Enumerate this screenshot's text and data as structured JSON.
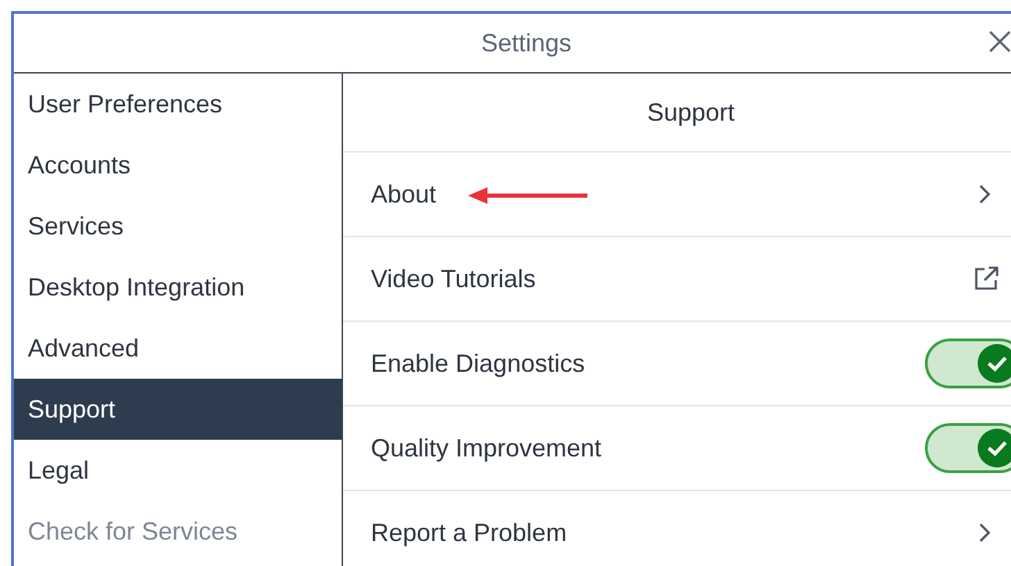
{
  "window": {
    "title": "Settings"
  },
  "sidebar": {
    "items": [
      {
        "label": "User Preferences",
        "selected": false,
        "disabled": false
      },
      {
        "label": "Accounts",
        "selected": false,
        "disabled": false
      },
      {
        "label": "Services",
        "selected": false,
        "disabled": false
      },
      {
        "label": "Desktop Integration",
        "selected": false,
        "disabled": false
      },
      {
        "label": "Advanced",
        "selected": false,
        "disabled": false
      },
      {
        "label": "Support",
        "selected": true,
        "disabled": false
      },
      {
        "label": "Legal",
        "selected": false,
        "disabled": false
      },
      {
        "label": "Check for Services",
        "selected": false,
        "disabled": true
      }
    ]
  },
  "panel": {
    "title": "Support",
    "rows": [
      {
        "label": "About",
        "kind": "link"
      },
      {
        "label": "Video Tutorials",
        "kind": "external"
      },
      {
        "label": "Enable Diagnostics",
        "kind": "toggle",
        "on": true
      },
      {
        "label": "Quality Improvement",
        "kind": "toggle",
        "on": true
      },
      {
        "label": "Report a Problem",
        "kind": "link"
      }
    ]
  }
}
